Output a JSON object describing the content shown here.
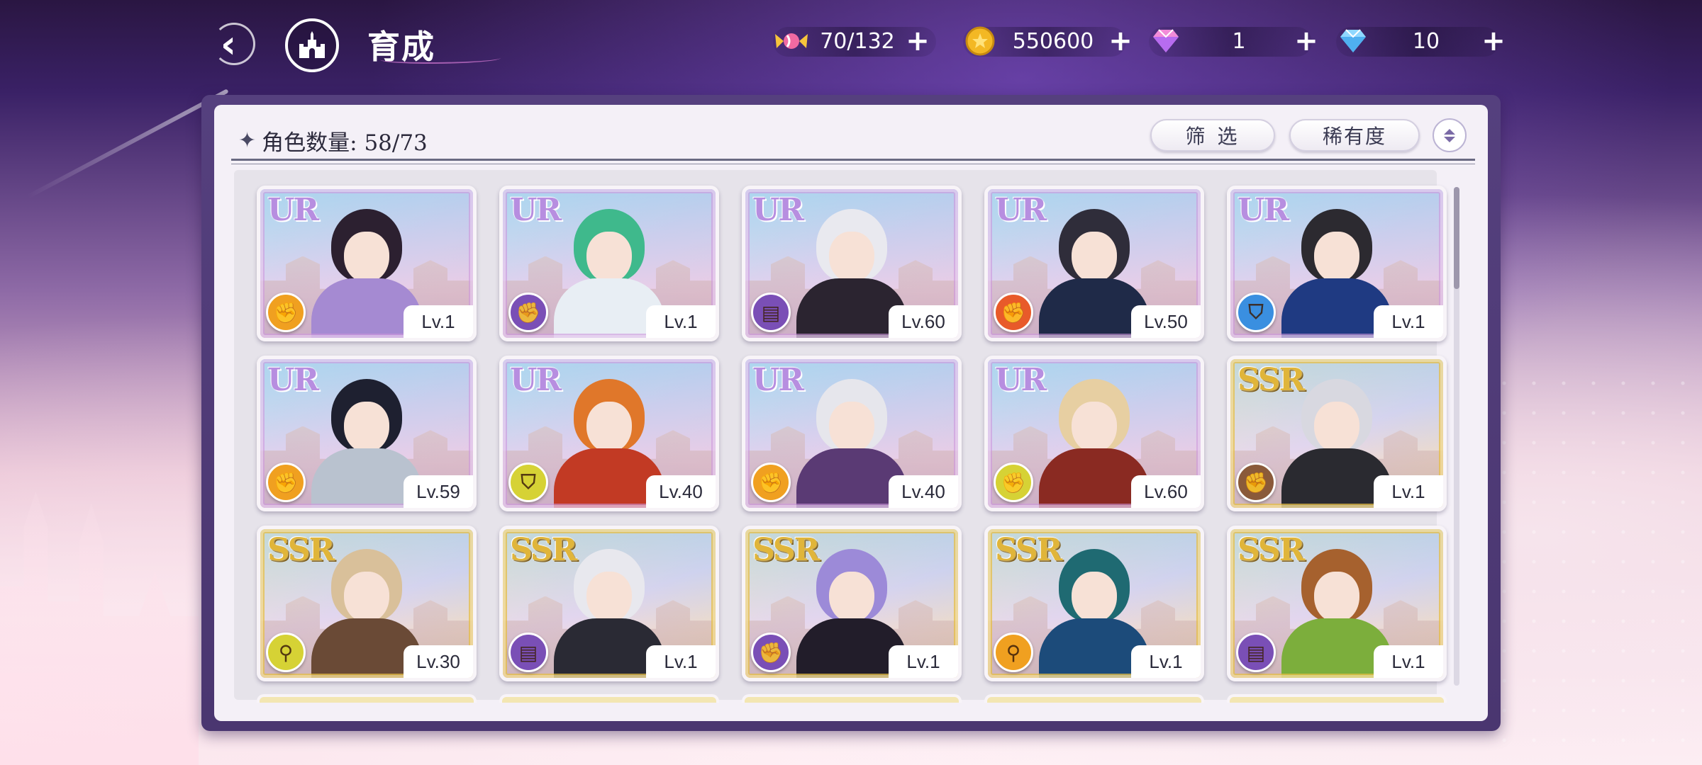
{
  "header": {
    "back_label": "‹",
    "home_icon": "castle-icon",
    "title": "育成"
  },
  "resources": [
    {
      "name": "candy",
      "icon": "candy-icon",
      "value": "70/132"
    },
    {
      "name": "gold",
      "icon": "gold-coin-icon",
      "value": "550600"
    },
    {
      "name": "pink-diamond",
      "icon": "pink-diamond-icon",
      "value": "1"
    },
    {
      "name": "blue-diamond",
      "icon": "blue-diamond-icon",
      "value": "10"
    }
  ],
  "panel": {
    "count_label": "角色数量: 58/73",
    "filter_label": "筛 选",
    "sort_label": "稀有度"
  },
  "colors": {
    "ur_rarity": "#b78ee0",
    "ssr_rarity": "#e0b53a",
    "role_orange": "#f0a020",
    "role_purple": "#7a4fb6",
    "role_red": "#e85a2a",
    "role_blue": "#3a8fe0",
    "role_yellow": "#d6d235"
  },
  "characters": [
    {
      "rarity": "UR",
      "level": "Lv.1",
      "role": "fist",
      "role_color": "#f0a020",
      "hair": "#2c2030",
      "outfit": "#a58ad2"
    },
    {
      "rarity": "UR",
      "level": "Lv.1",
      "role": "fist",
      "role_color": "#7a4fb6",
      "hair": "#3fb98c",
      "outfit": "#e8eef4"
    },
    {
      "rarity": "UR",
      "level": "Lv.60",
      "role": "book",
      "role_color": "#7a4fb6",
      "hair": "#e9e9ef",
      "outfit": "#2b2430"
    },
    {
      "rarity": "UR",
      "level": "Lv.50",
      "role": "fist",
      "role_color": "#e85a2a",
      "hair": "#2f2d3a",
      "outfit": "#1f2a48"
    },
    {
      "rarity": "UR",
      "level": "Lv.1",
      "role": "shield",
      "role_color": "#3a8fe0",
      "hair": "#2c2a30",
      "outfit": "#1f3a82"
    },
    {
      "rarity": "UR",
      "level": "Lv.59",
      "role": "fist",
      "role_color": "#f0a020",
      "hair": "#1e2030",
      "outfit": "#b9c2cf"
    },
    {
      "rarity": "UR",
      "level": "Lv.40",
      "role": "shield",
      "role_color": "#d6d235",
      "hair": "#e0772a",
      "outfit": "#c23a24"
    },
    {
      "rarity": "UR",
      "level": "Lv.40",
      "role": "fist",
      "role_color": "#f0a020",
      "hair": "#e6e6ec",
      "outfit": "#5a3a74"
    },
    {
      "rarity": "UR",
      "level": "Lv.60",
      "role": "fist",
      "role_color": "#d6d235",
      "hair": "#e7cfa2",
      "outfit": "#8a2a22"
    },
    {
      "rarity": "SSR",
      "level": "Lv.1",
      "role": "fist",
      "role_color": "#8a5a3a",
      "hair": "#d8d8e0",
      "outfit": "#2a2a30"
    },
    {
      "rarity": "SSR",
      "level": "Lv.30",
      "role": "staff",
      "role_color": "#d6d235",
      "hair": "#d9c09a",
      "outfit": "#6a4a36"
    },
    {
      "rarity": "SSR",
      "level": "Lv.1",
      "role": "book",
      "role_color": "#7a4fb6",
      "hair": "#e8e8ee",
      "outfit": "#2a2a34"
    },
    {
      "rarity": "SSR",
      "level": "Lv.1",
      "role": "fist",
      "role_color": "#7a4fb6",
      "hair": "#9c8ad8",
      "outfit": "#221d2a"
    },
    {
      "rarity": "SSR",
      "level": "Lv.1",
      "role": "staff",
      "role_color": "#f0a020",
      "hair": "#1f6a72",
      "outfit": "#1c4b7a"
    },
    {
      "rarity": "SSR",
      "level": "Lv.1",
      "role": "book",
      "role_color": "#7a4fb6",
      "hair": "#a6612e",
      "outfit": "#7cae3c"
    }
  ]
}
